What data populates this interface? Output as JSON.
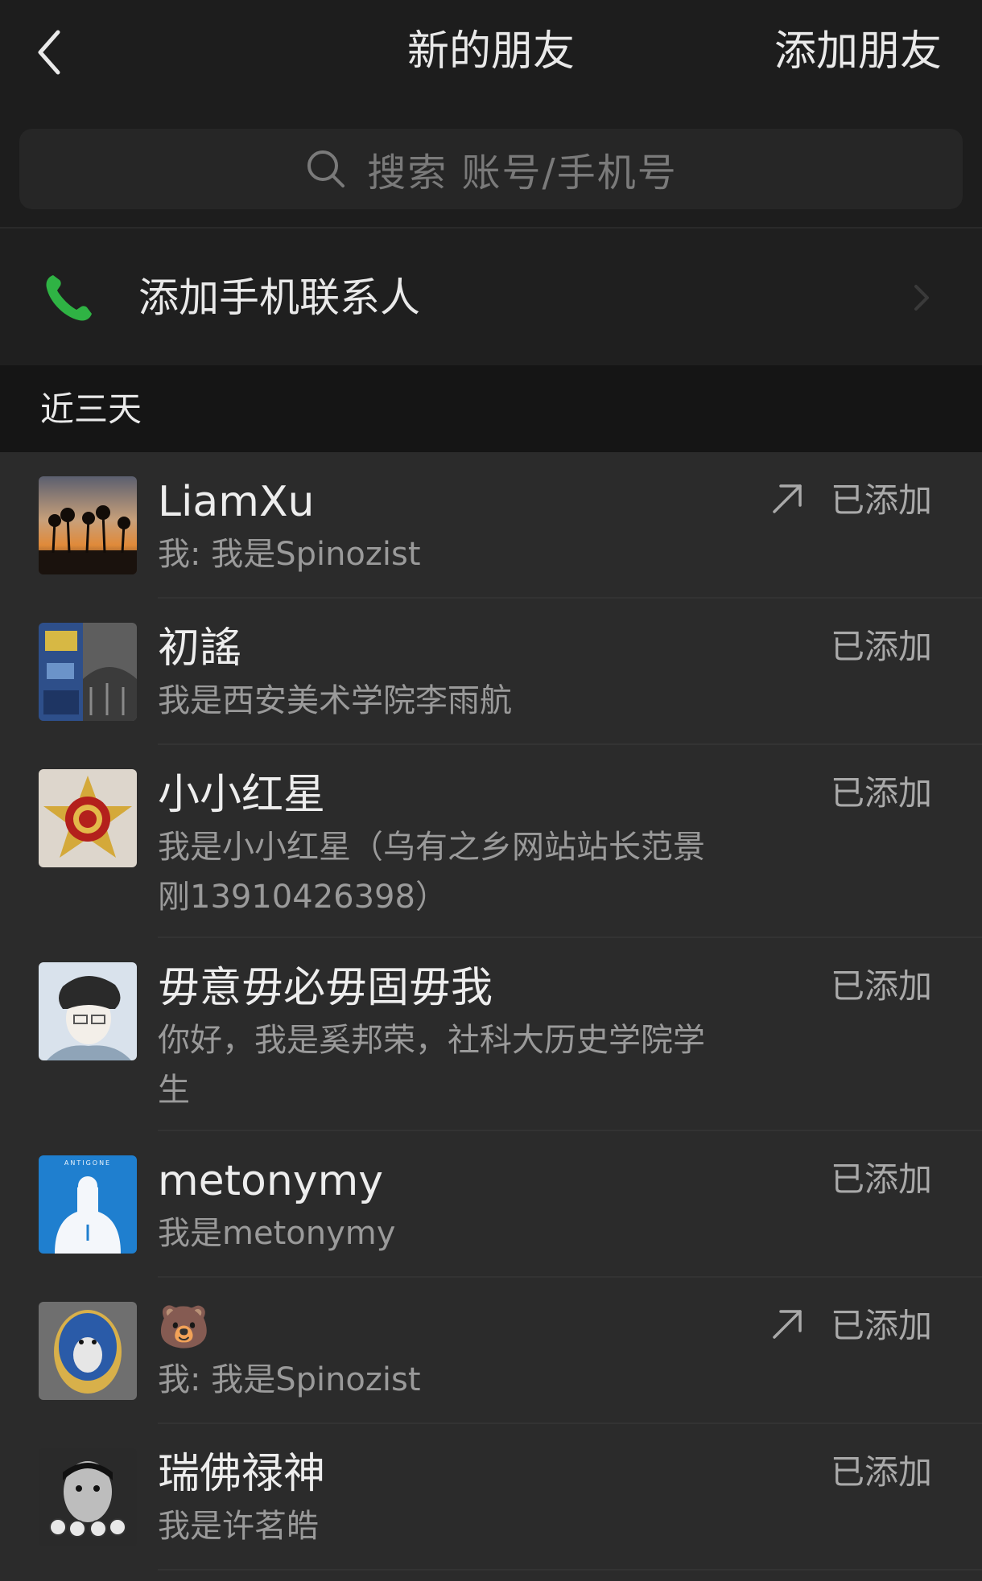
{
  "header": {
    "title": "新的朋友",
    "add_friend": "添加朋友",
    "back_icon": "chevron-left-icon"
  },
  "search": {
    "placeholder": "搜索 账号/手机号",
    "icon": "search-icon"
  },
  "phone_contacts": {
    "label": "添加手机联系人",
    "icon": "phone-icon",
    "icon_color": "#2fb344"
  },
  "section": {
    "label": "近三天"
  },
  "friends": [
    {
      "name": "LiamXu",
      "message": "我: 我是Spinozist",
      "status": "已添加",
      "forwarded": true
    },
    {
      "name": "初謠",
      "message": "我是西安美术学院李雨航",
      "status": "已添加",
      "forwarded": false
    },
    {
      "name": "小小红星",
      "message": "我是小小红星（乌有之乡网站站长范景刚13910426398）",
      "status": "已添加",
      "forwarded": false
    },
    {
      "name": "毋意毋必毋固毋我",
      "message": "你好，我是奚邦荣，社科大历史学院学生",
      "status": "已添加",
      "forwarded": false
    },
    {
      "name": "metonymy",
      "message": "我是metonymy",
      "status": "已添加",
      "forwarded": false
    },
    {
      "name": "🐻",
      "message": "我: 我是Spinozist",
      "status": "已添加",
      "forwarded": true
    },
    {
      "name": "瑞佛禄神",
      "message": "我是许茗皓",
      "status": "已添加",
      "forwarded": false
    }
  ]
}
